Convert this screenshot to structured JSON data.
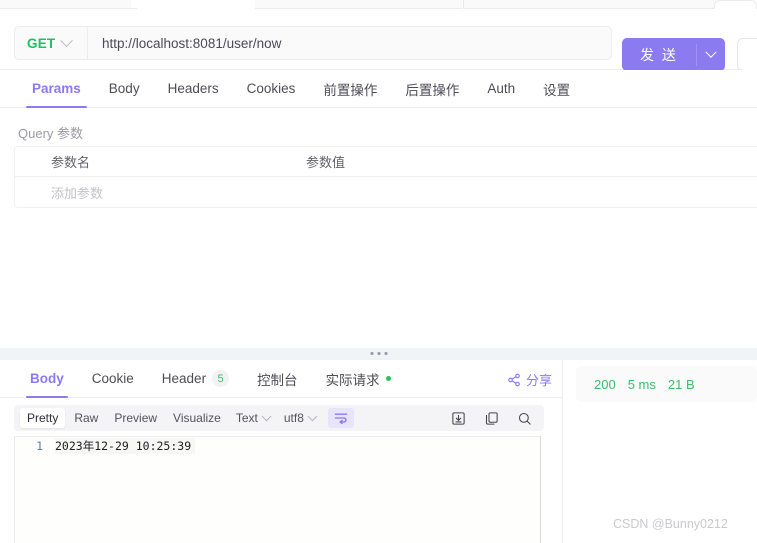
{
  "request": {
    "method": "GET",
    "url": "http://localhost:8081/user/now",
    "send_label": "发 送",
    "tabs": [
      {
        "label": "Params",
        "active": true
      },
      {
        "label": "Body",
        "active": false
      },
      {
        "label": "Headers",
        "active": false
      },
      {
        "label": "Cookies",
        "active": false
      },
      {
        "label": "前置操作",
        "active": false
      },
      {
        "label": "后置操作",
        "active": false
      },
      {
        "label": "Auth",
        "active": false
      },
      {
        "label": "设置",
        "active": false
      }
    ],
    "query_params": {
      "title": "Query 参数",
      "col_name": "参数名",
      "col_value": "参数值",
      "add_placeholder": "添加参数"
    }
  },
  "response": {
    "tabs": [
      {
        "label": "Body",
        "active": true,
        "badge": null,
        "dot": false
      },
      {
        "label": "Cookie",
        "active": false,
        "badge": null,
        "dot": false
      },
      {
        "label": "Header",
        "active": false,
        "badge": "5",
        "dot": false
      },
      {
        "label": "控制台",
        "active": false,
        "badge": null,
        "dot": false
      },
      {
        "label": "实际请求",
        "active": false,
        "badge": null,
        "dot": true
      }
    ],
    "share_label": "分享",
    "status": {
      "code": "200",
      "time": "5 ms",
      "size": "21 B"
    },
    "toolbar": {
      "views": [
        {
          "label": "Pretty",
          "active": true
        },
        {
          "label": "Raw",
          "active": false
        },
        {
          "label": "Preview",
          "active": false
        },
        {
          "label": "Visualize",
          "active": false
        }
      ],
      "format_select": "Text",
      "charset_select": "utf8"
    },
    "body_lines": [
      {
        "no": "1",
        "text": "2023年12-29 10:25:39"
      }
    ]
  },
  "watermark": "CSDN @Bunny0212",
  "colors": {
    "accent": "#8b7af0",
    "method_green": "#20c060",
    "status_green": "#3bbd6a"
  }
}
